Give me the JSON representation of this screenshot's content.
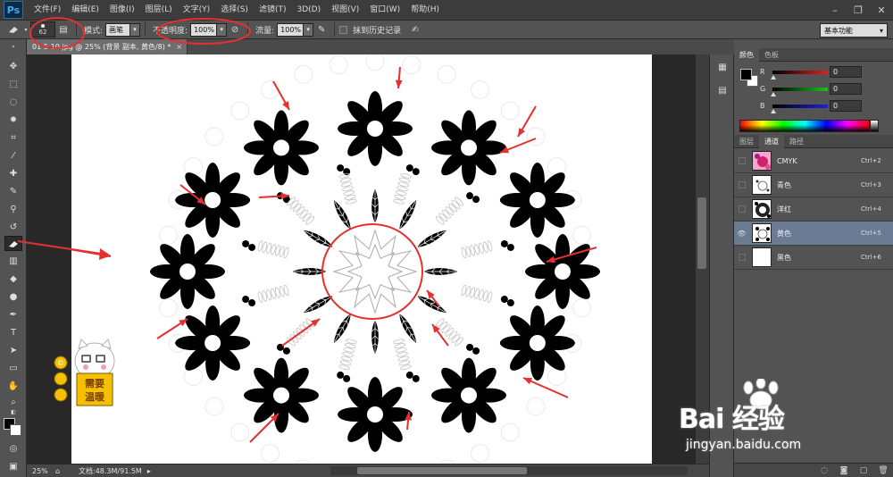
{
  "app": {
    "logo": "Ps"
  },
  "menu": [
    "文件(F)",
    "编辑(E)",
    "图像(I)",
    "图层(L)",
    "文字(Y)",
    "选择(S)",
    "滤镜(T)",
    "3D(D)",
    "视图(V)",
    "窗口(W)",
    "帮助(H)"
  ],
  "options": {
    "brush_size": "62",
    "mode_label": "模式:",
    "mode_value": "画笔",
    "opacity_label": "不透明度:",
    "opacity_value": "100%",
    "flow_label": "流量:",
    "flow_value": "100%",
    "history_label": "抹到历史记录",
    "workspace": "基本功能"
  },
  "document": {
    "tab_title": "01 5-10.jpg @ 25% (背景 副本, 黄色/8) *",
    "close": "×",
    "zoom": "25%",
    "doc_info": "文档:48.3M/91.5M"
  },
  "color_panel": {
    "tabs": [
      "颜色",
      "色板"
    ],
    "channels": [
      {
        "label": "R",
        "value": "0",
        "color": "#e02020"
      },
      {
        "label": "G",
        "value": "0",
        "color": "#20c020"
      },
      {
        "label": "B",
        "value": "0",
        "color": "#2020e0"
      }
    ]
  },
  "channels_panel": {
    "tabs": [
      "图层",
      "通道",
      "路径"
    ],
    "active_tab": "通道",
    "rows": [
      {
        "name": "CMYK",
        "shortcut": "Ctrl+2",
        "visible": false,
        "selected": false
      },
      {
        "name": "青色",
        "shortcut": "Ctrl+3",
        "visible": false,
        "selected": false
      },
      {
        "name": "洋红",
        "shortcut": "Ctrl+4",
        "visible": false,
        "selected": false
      },
      {
        "name": "黄色",
        "shortcut": "Ctrl+5",
        "visible": true,
        "selected": true
      },
      {
        "name": "黑色",
        "shortcut": "Ctrl+6",
        "visible": false,
        "selected": false
      }
    ]
  },
  "mascot": {
    "sign_line1": "需要",
    "sign_line2": "温暖"
  },
  "watermark": {
    "brand": "Bai 经验",
    "url": "jingyan.baidu.com"
  },
  "colors": {
    "annotation_red": "#e53030",
    "selected_row": "#6c7b94"
  }
}
